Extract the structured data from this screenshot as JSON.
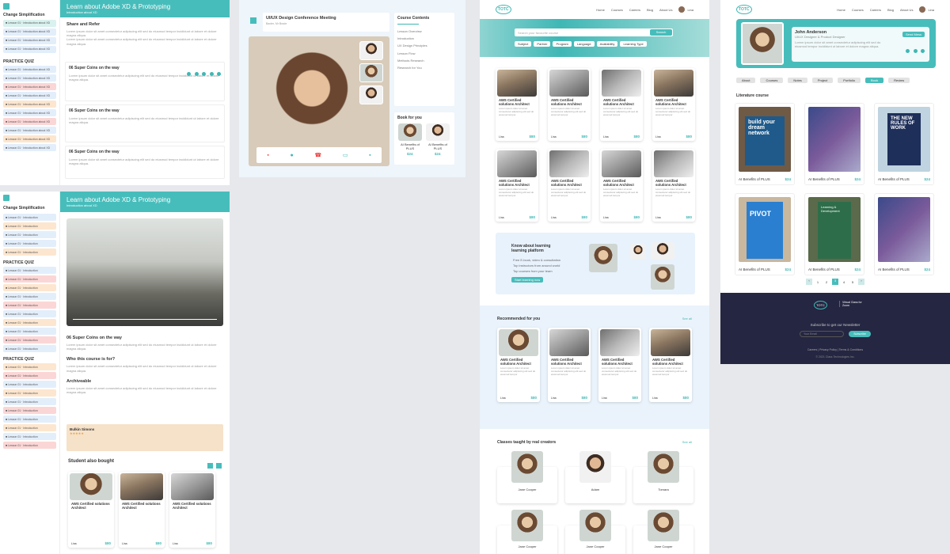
{
  "panel1": {
    "title": "Learn about Adobe XD & Prototyping",
    "subtitle": "Introduction about XD",
    "section_title": "Change Simplification",
    "share_title": "Share and Refer",
    "practice_title": "PRACTICE QUIZ",
    "super_coins": "06 Super Coins on the way",
    "lorem": "Lorem ipsum dolor sit amet consectetur adipiscing elit sed do eiusmod tempor incididunt ut labore et dolore magna aliqua."
  },
  "panel2": {
    "title": "Learn about Adobe XD & Prototyping",
    "subtitle": "Introduction about XD",
    "section_title": "Change Simplification",
    "practice_title": "PRACTICE QUIZ",
    "h_super": "06 Super Coins on the way",
    "h_who": "Who this course is for?",
    "h_archive": "Archiveable",
    "reviewer": "Bulkin Simons",
    "also_bought": "Student also bought",
    "card_title": "AWS Certified solutions Architect",
    "card_price": "$80"
  },
  "panel3": {
    "meeting_title": "UI/UX Design Conference Meeting",
    "meeting_sub": "Baxter, Mr Brade",
    "contents_title": "Course Contents",
    "book_title": "Book for you",
    "book1": "AI Benefits of PLUS",
    "book1_price": "$24",
    "book2": "AI Benefits of PLUS",
    "book2_price": "$24"
  },
  "panel4": {
    "logo": "TOTC",
    "nav": [
      "Home",
      "Courses",
      "Careers",
      "Blog",
      "About Us"
    ],
    "user": "Lina",
    "search_placeholder": "Search your favourite course",
    "search_btn": "Search",
    "filters": [
      "Subject",
      "Partner",
      "Program",
      "Language",
      "Availability",
      "Learning Type"
    ],
    "card_title": "AWS Certified solutions Architect",
    "card_desc": "Lorem ipsum dolor sit amet consectetur adipiscing elit sed do eiusmod tempor",
    "card_price": "$80",
    "card_old": "$100",
    "card_author": "Lina",
    "learn_title": "Know about learning learning platform",
    "learn_points": [
      "Free E-book, video & consultation",
      "Top instructors from around world",
      "Top courses from your team"
    ],
    "learn_btn": "Start learning now",
    "recommended": "Recommended for you",
    "see_all": "See all",
    "classes_title": "Classes taught by real creators",
    "creator1": "Jane Cooper",
    "creator2": "Adam",
    "creator3": "Tomara"
  },
  "panel5": {
    "logo": "TOTC",
    "nav": [
      "Home",
      "Courses",
      "Careers",
      "Blog",
      "About Us"
    ],
    "user": "Lina",
    "profile_name": "John Anderson",
    "profile_role": "UI/UX Designer & Product Designer",
    "profile_btn": "Send Mess",
    "tabs": [
      "About",
      "Courses",
      "Notes",
      "Project",
      "Portfolio",
      "Book",
      "Review"
    ],
    "active_tab": "Book",
    "lit_title": "Literature course",
    "book_label": "AI Benefits of PLUS",
    "book_price": "$24",
    "covers": [
      "build your dream network",
      "THE NEW RULES OF WORK",
      "PIVOT",
      "Learning & Development"
    ],
    "pages": [
      "1",
      "2",
      "3",
      "4",
      "5"
    ],
    "footer_logo": "TOTC",
    "footer_tag": "Virtual Class for Zoom",
    "newsletter": "Subscribe to get our Newsletter",
    "email_ph": "Your Email",
    "subscribe": "Subscribe",
    "footer_links": [
      "Careers",
      "Privacy Policy",
      "Terms & Conditions"
    ],
    "copyright": "© 2021 Class Technologies Inc."
  }
}
